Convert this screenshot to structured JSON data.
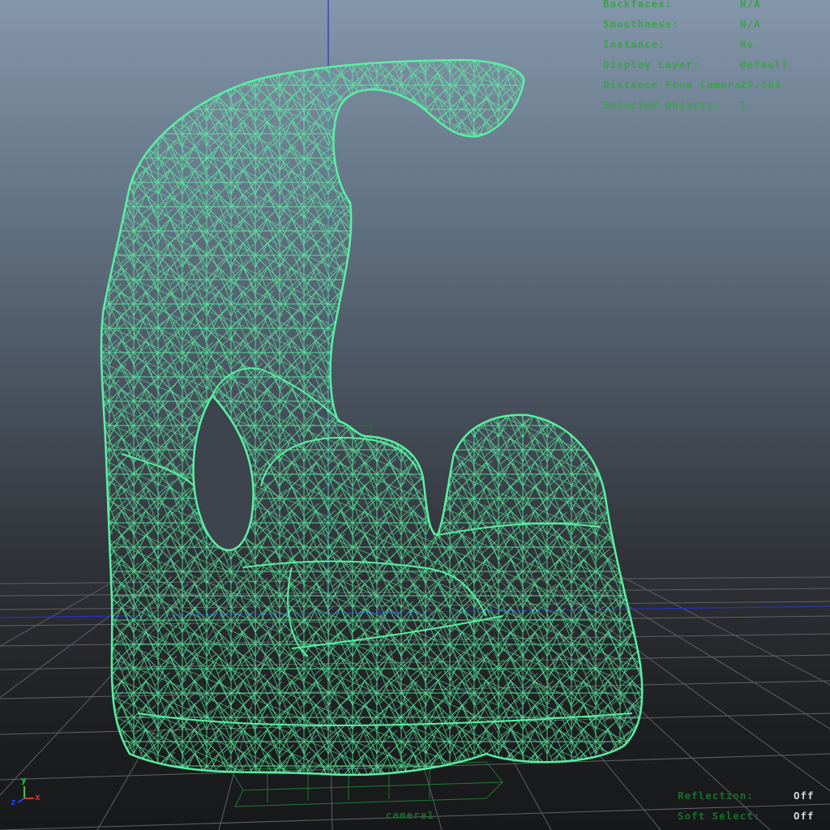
{
  "viewport": {
    "colors": {
      "wireframe": "#59f0a2",
      "grid": "#5d6166",
      "axis_blue": "#2a32b8",
      "hud_text": "#3aa34a",
      "hud_value_bright": "#d6d6d6"
    }
  },
  "hud": {
    "rows": [
      {
        "label": "Backfaces:",
        "value": "N/A"
      },
      {
        "label": "Smoothness:",
        "value": "N/A"
      },
      {
        "label": "Instance:",
        "value": "No"
      },
      {
        "label": "Display Layer:",
        "value": "default"
      },
      {
        "label": "Distance From Camera:",
        "value": "25.564"
      },
      {
        "label": "Selected Objects:",
        "value": "1"
      }
    ],
    "bottom_rows": [
      {
        "label": "Reflection:",
        "value": "Off"
      },
      {
        "label": "Soft Select:",
        "value": "Off"
      }
    ]
  },
  "camera": {
    "label": "camera1"
  },
  "axis_gizmo": {
    "x_label": "x",
    "y_label": "y",
    "z_label": "z",
    "icon": "axis-gizmo-icon"
  }
}
